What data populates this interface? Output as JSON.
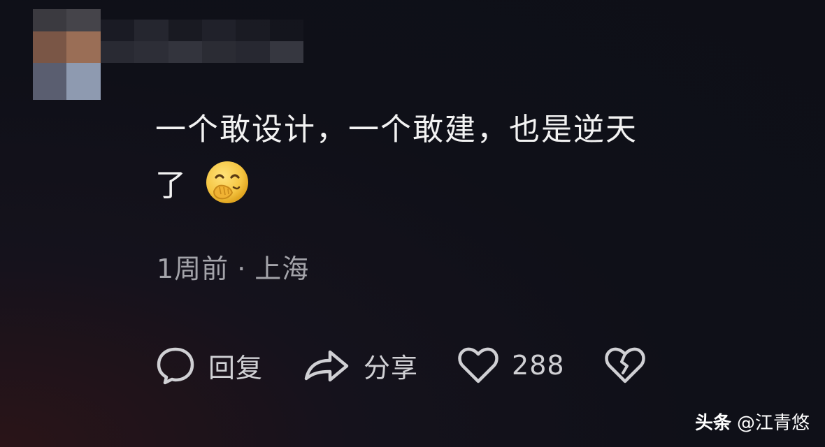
{
  "comment": {
    "text_line1": "一个敢设计，一个敢建，也是逆天",
    "text_line2": "了",
    "emoji": "hand-over-mouth-emoji"
  },
  "meta": {
    "time": "1周前",
    "separator": "·",
    "location": "上海"
  },
  "actions": {
    "reply_label": "回复",
    "share_label": "分享",
    "like_count": "288"
  },
  "watermark": {
    "brand": "头条",
    "handle": "@江青悠"
  },
  "colors": {
    "background": "#0e0f17",
    "text": "#f2f2f2",
    "meta": "#a4a4aa",
    "icon": "#d0d0d4",
    "emoji": "#f5c542"
  }
}
